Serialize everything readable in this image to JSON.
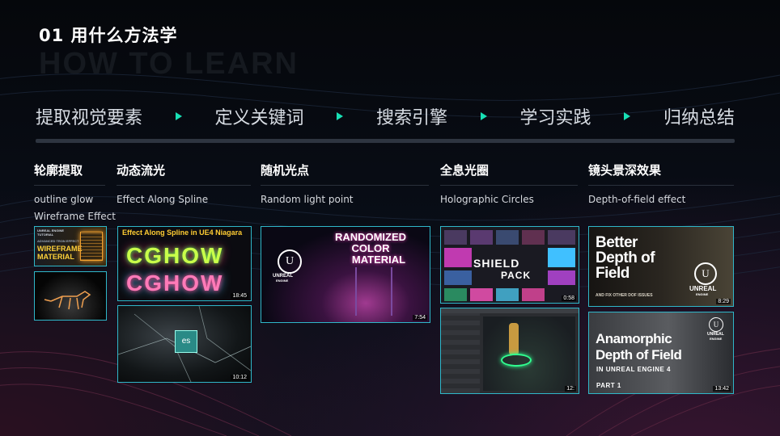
{
  "header": {
    "title": "01 用什么方法学",
    "subtitle": "HOW TO LEARN"
  },
  "steps": [
    "提取视觉要素",
    "定义关键词",
    "搜索引擎",
    "学习实践",
    "归纳总结"
  ],
  "columns": [
    {
      "heading": "轮廓提取",
      "desc": [
        "outline glow",
        "Wireframe Effect"
      ]
    },
    {
      "heading": "动态流光",
      "desc": [
        "Effect Along Spline"
      ]
    },
    {
      "heading": "随机光点",
      "desc": [
        "Random light point"
      ]
    },
    {
      "heading": "全息光圈",
      "desc": [
        "Holographic Circles"
      ]
    },
    {
      "heading": "镜头景深效果",
      "desc": [
        "Depth-of-field effect"
      ]
    }
  ],
  "thumbs": {
    "wireframe": {
      "l1": "UNREAL ENGINE",
      "l2": "TUTORIAL",
      "l3": "ADVANCED TRON EFFECT",
      "l4": "WIREFRAME",
      "l5": "MATERIAL"
    },
    "cghow": {
      "banner": "Effect Along Spline in UE4 Niagara",
      "text": "CGHOW",
      "duration": "18:45"
    },
    "city": {
      "logo": "es",
      "duration": "10:12"
    },
    "random": {
      "line1": "RANDOMIZED",
      "line2": "COLOR",
      "line3": "MATERIAL",
      "ue": "UNREAL",
      "ue2": "ENGINE",
      "duration": "7:54"
    },
    "shield": {
      "line1": "SHIELD",
      "line2": "PACK",
      "duration": "0:58"
    },
    "holo": {
      "duration": "12:"
    },
    "dof1": {
      "line1": "Better",
      "line2": "Depth of",
      "line3": "Field",
      "small": "AND FIX OTHER DOF ISSUES",
      "ue": "UNREAL",
      "ue2": "ENGINE",
      "duration": "8:29"
    },
    "dof2": {
      "line1": "Anamorphic",
      "line2": "Depth of Field",
      "line3": "IN UNREAL ENGINE 4",
      "line4": "PART 1",
      "ue": "UNREAL",
      "ue2": "ENGINE",
      "duration": "13:42"
    }
  },
  "colors": {
    "accent": "#18e0b5",
    "border": "#2fb7c9"
  }
}
